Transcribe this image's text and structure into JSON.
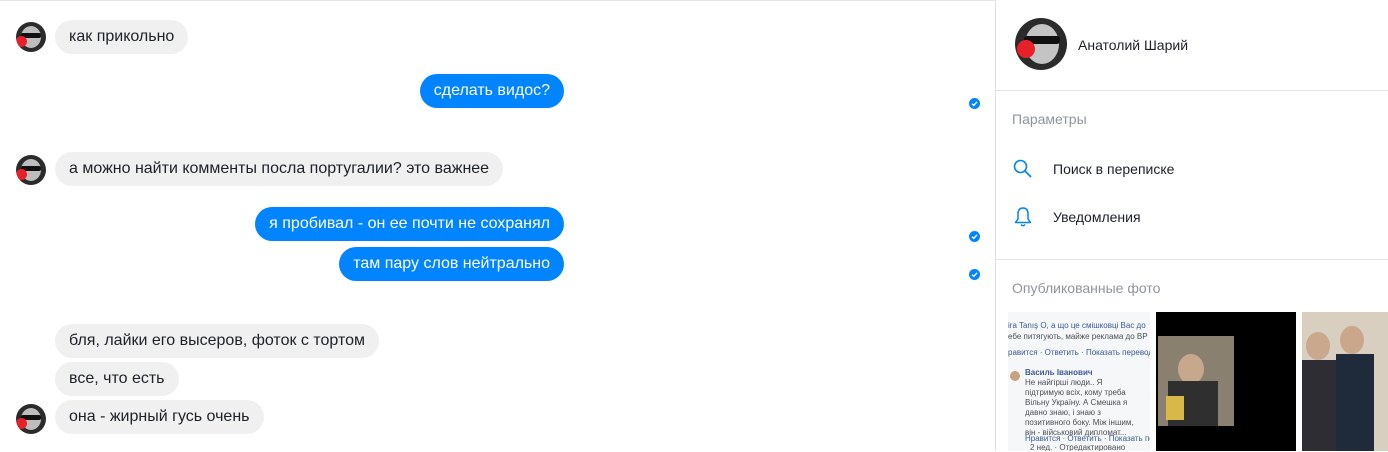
{
  "messages": [
    {
      "dir": "in",
      "text": "как прикольно",
      "avatar": true
    },
    {
      "dir": "out",
      "text": "сделать видос?"
    },
    {
      "dir": "in",
      "text": "а можно найти комменты посла португалии? это важнее",
      "avatar": true
    },
    {
      "dir": "out",
      "text": "я пробивал - он ее почти не сохранял"
    },
    {
      "dir": "out",
      "text": "там пару слов нейтрально"
    },
    {
      "dir": "in",
      "text": "бля, лайки его высеров, фоток с тортом"
    },
    {
      "dir": "in",
      "text": "все, что есть"
    },
    {
      "dir": "in",
      "text": "она - жирный гусь очень",
      "avatar": true
    }
  ],
  "sidebar": {
    "profile_name": "Анатолий Шарий",
    "settings_title": "Параметры",
    "options": [
      {
        "label": "Поиск в переписке",
        "icon": "search-icon"
      },
      {
        "label": "Уведомления",
        "icon": "bell-icon"
      }
    ],
    "photos_title": "Опубликованные фото",
    "photo_snippet": {
      "line1": "ira Tanış О, а що це смішковці Вас до",
      "line2": "ебе питягують, майже реклама до ВР",
      "actions1": "равится · Ответить · Показать перевод",
      "commenter": "Василь Іванович",
      "comment": "Не найгірші люди.. Я підтримую всіх, кому треба Вільну Україну. А Смешка я давно знаю, і знаю з позитивного боку. Між іншим, він - військовий дипломат...",
      "actions2": "Нравится · Ответить · Показать пер",
      "meta": "2 нед. · Отредактировано"
    }
  },
  "colors": {
    "accent": "#0084ff",
    "incoming": "#f1f0f0",
    "text": "#1d2129",
    "muted": "#90949c"
  }
}
